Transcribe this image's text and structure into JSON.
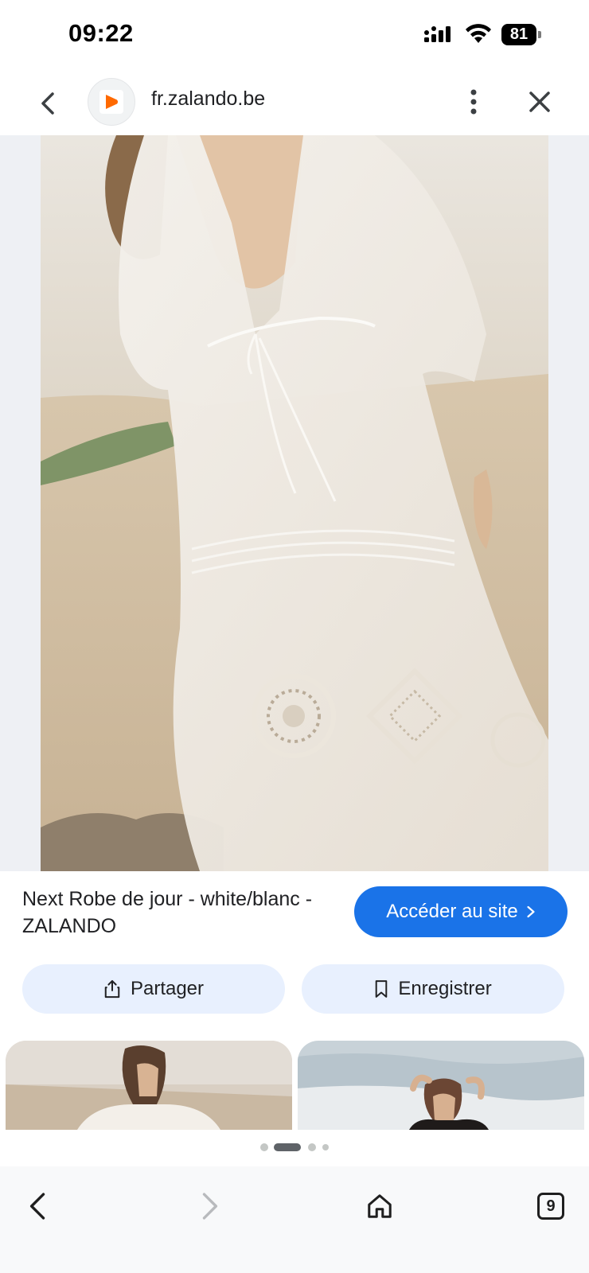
{
  "status_bar": {
    "time": "09:22",
    "battery": "81",
    "icons": [
      "signal-icon",
      "wifi-icon",
      "battery-icon"
    ]
  },
  "url_bar": {
    "url": "fr.zalando.be",
    "icons": [
      "back-chevron-icon",
      "zalando-favicon-icon",
      "more-vert-icon",
      "close-icon"
    ]
  },
  "result": {
    "title": "Next Robe de jour - white/blanc - ZALANDO",
    "visit_label": "Accéder au site",
    "visit_icon": "chevron-right-icon"
  },
  "actions": {
    "share_label": "Partager",
    "share_icon": "share-icon",
    "save_label": "Enregistrer",
    "save_icon": "bookmark-icon"
  },
  "pager": {
    "count": 4,
    "active": 1
  },
  "bottom_nav": {
    "tabs_count": "9",
    "icons": [
      "back-arrow-icon",
      "forward-arrow-icon",
      "home-icon",
      "tabs-icon"
    ]
  },
  "colors": {
    "accent": "#1a73e8",
    "pill_bg": "#e8f0fe",
    "favicon": "#ff6900",
    "image_bg": "#eef0f4"
  }
}
